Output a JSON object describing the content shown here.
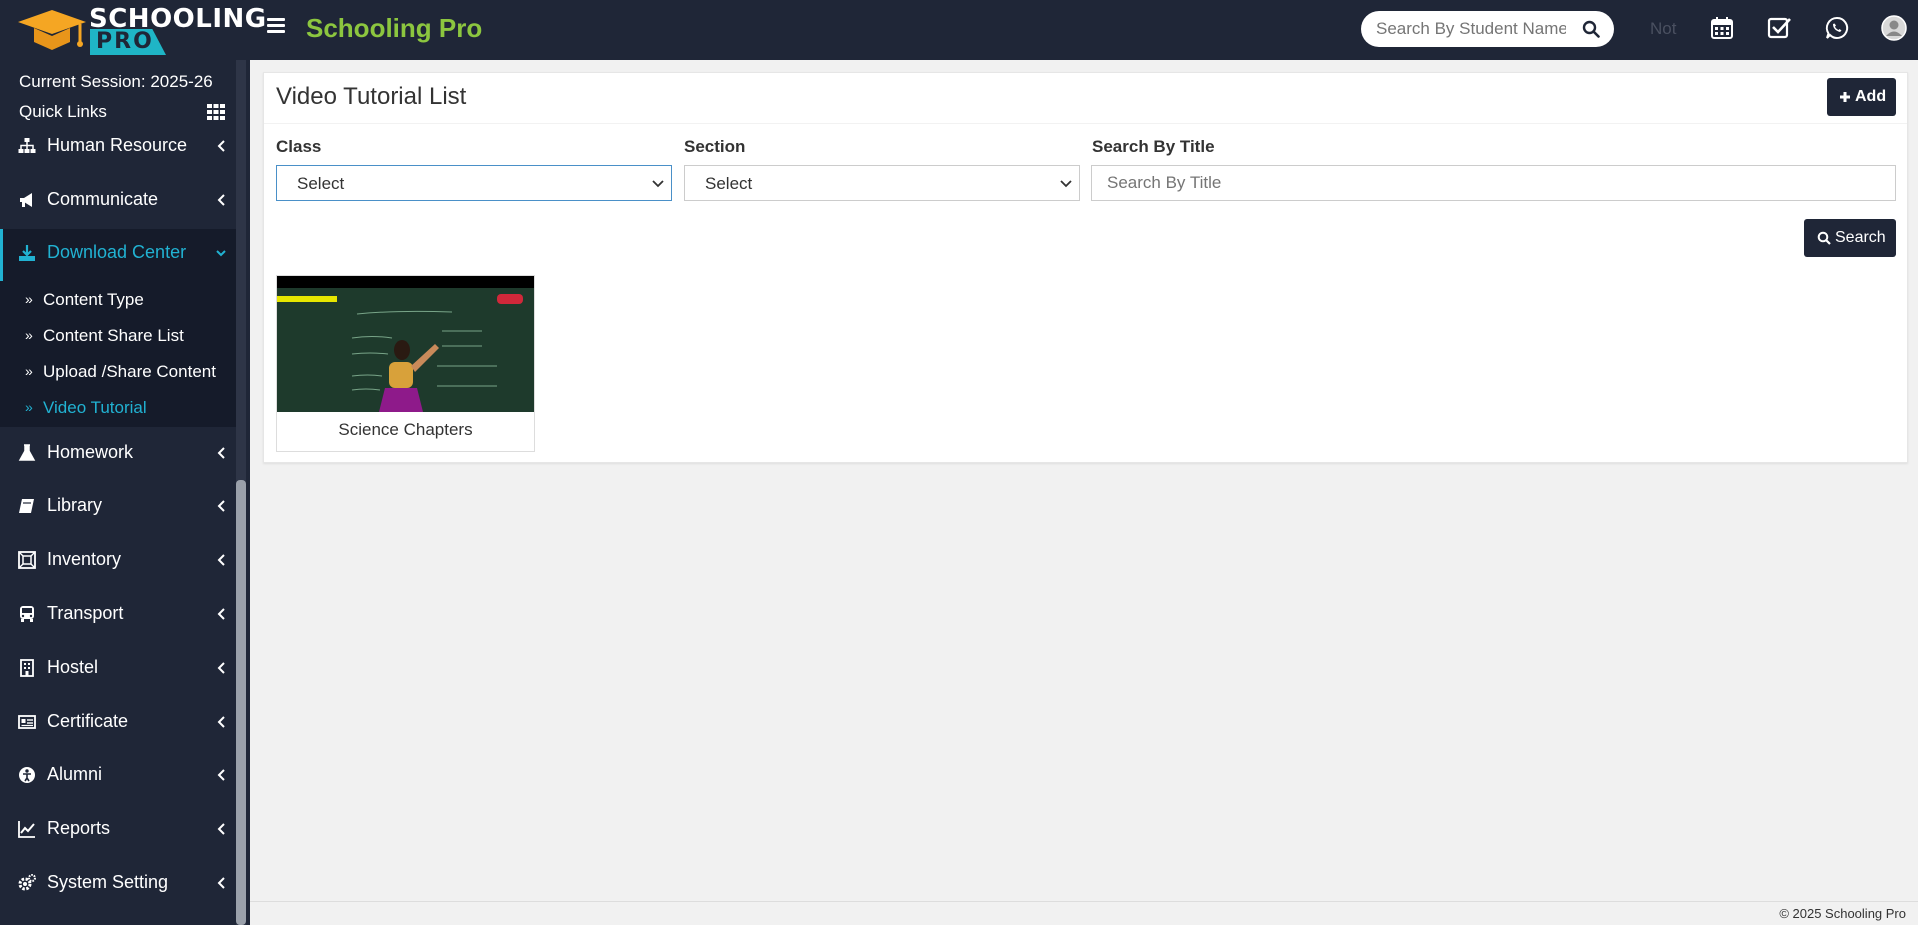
{
  "header": {
    "logo_line1": "SCHOOLING",
    "logo_line2": "PRO",
    "app_title": "Schooling Pro",
    "search_placeholder": "Search By Student Name",
    "notice_label": "Not",
    "icons": [
      "calendar-icon",
      "checkbox-icon",
      "whatsapp-icon",
      "user-avatar-icon"
    ]
  },
  "sidebar": {
    "session": "Current Session: 2025-26",
    "quick_links": "Quick Links",
    "items": [
      {
        "label": "Human Resource",
        "icon": "sitemap-icon"
      },
      {
        "label": "Communicate",
        "icon": "bullhorn-icon"
      },
      {
        "label": "Download Center",
        "icon": "download-icon",
        "active": true
      },
      {
        "label": "Homework",
        "icon": "flask-icon"
      },
      {
        "label": "Library",
        "icon": "book-icon"
      },
      {
        "label": "Inventory",
        "icon": "inventory-icon"
      },
      {
        "label": "Transport",
        "icon": "bus-icon"
      },
      {
        "label": "Hostel",
        "icon": "building-icon"
      },
      {
        "label": "Certificate",
        "icon": "certificate-icon"
      },
      {
        "label": "Alumni",
        "icon": "alumni-icon"
      },
      {
        "label": "Reports",
        "icon": "chart-line-icon"
      },
      {
        "label": "System Setting",
        "icon": "gears-icon"
      }
    ],
    "subitems": [
      {
        "label": "Content Type"
      },
      {
        "label": "Content Share List"
      },
      {
        "label": "Upload /Share Content"
      },
      {
        "label": "Video Tutorial",
        "active": true
      }
    ]
  },
  "main": {
    "title": "Video Tutorial List",
    "add_label": "Add",
    "filters": {
      "class_label": "Class",
      "class_value": "Select",
      "section_label": "Section",
      "section_value": "Select",
      "title_label": "Search By Title",
      "title_placeholder": "Search By Title"
    },
    "search_label": "Search",
    "videos": [
      {
        "title": "Science Chapters"
      }
    ]
  },
  "footer": {
    "text": "© 2025 Schooling Pro"
  },
  "colors": {
    "sidebar_bg": "#1f2637",
    "accent": "#21b2d2",
    "brand_green": "#8cc63f"
  }
}
